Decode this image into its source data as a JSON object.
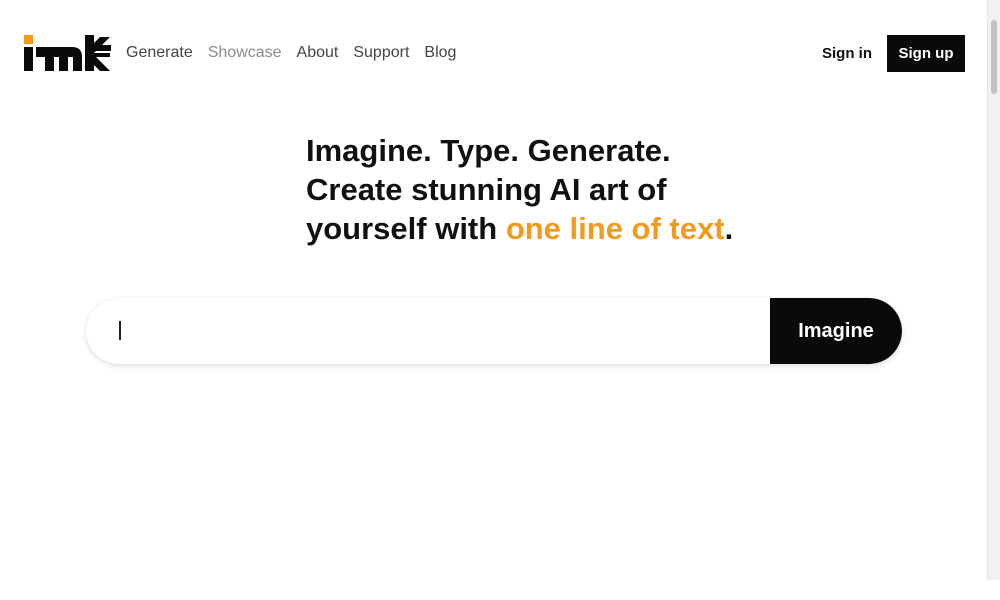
{
  "brand": {
    "logo_icon": "mk-logo",
    "colors": {
      "accent": "#f39a1e",
      "primary": "#0a0a0a"
    }
  },
  "nav": {
    "items": [
      {
        "label": "Generate"
      },
      {
        "label": "Showcase"
      },
      {
        "label": "About"
      },
      {
        "label": "Support"
      },
      {
        "label": "Blog"
      }
    ]
  },
  "auth": {
    "signin_label": "Sign in",
    "signup_label": "Sign up"
  },
  "hero": {
    "line1": "Imagine. Type. Generate.",
    "line2": "Create stunning AI art of",
    "line3_prefix": "yourself with ",
    "line3_highlight": "one line of text",
    "line3_suffix": "."
  },
  "search": {
    "value": "",
    "placeholder": "",
    "button_label": "Imagine"
  }
}
